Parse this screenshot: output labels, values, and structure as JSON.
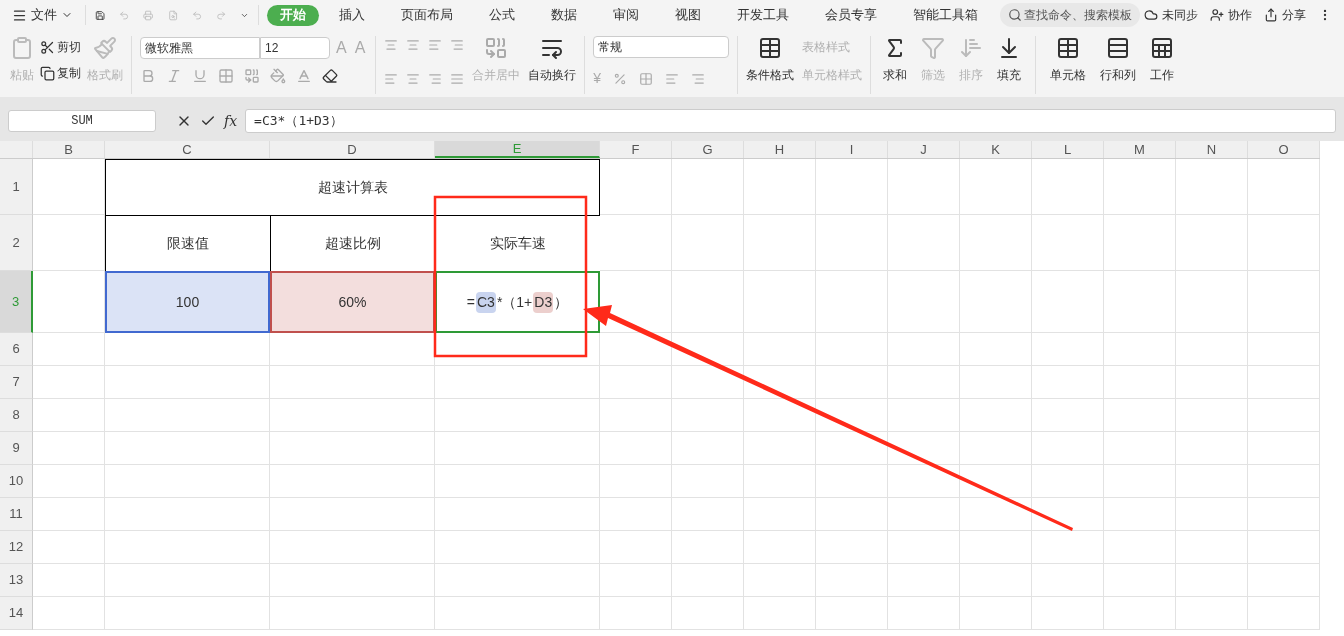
{
  "menu": {
    "file": "文件",
    "tabs": [
      {
        "label": "开始",
        "selected": true
      },
      {
        "label": "插入",
        "selected": false
      },
      {
        "label": "页面布局",
        "selected": false
      },
      {
        "label": "公式",
        "selected": false
      },
      {
        "label": "数据",
        "selected": false
      },
      {
        "label": "审阅",
        "selected": false
      },
      {
        "label": "视图",
        "selected": false
      },
      {
        "label": "开发工具",
        "selected": false
      },
      {
        "label": "会员专享",
        "selected": false
      },
      {
        "label": "智能工具箱",
        "selected": false
      }
    ],
    "search": {
      "placeholder": "查找命令、搜索模板"
    },
    "actions": [
      {
        "kind": "sync",
        "label": "未同步"
      },
      {
        "kind": "collab",
        "label": "协作"
      },
      {
        "kind": "share",
        "label": "分享"
      }
    ]
  },
  "ribbon": {
    "paste": {
      "label": "粘贴",
      "disabled": true
    },
    "cut": {
      "label": "剪切",
      "disabled": false
    },
    "copy": {
      "label": "复制",
      "disabled": false
    },
    "format_painter": {
      "label": "格式刷",
      "disabled": true
    },
    "font": "微软雅黑",
    "size": "12",
    "font_grow": "A",
    "font_shrink": "A",
    "currency": "¥",
    "merge": {
      "label": "合并居中",
      "disabled": true
    },
    "wrap": {
      "label": "自动换行",
      "disabled": false
    },
    "number_format": "常规",
    "conditional": {
      "label": "条件格式",
      "disabled": false
    },
    "table_style": {
      "label": "表格样式",
      "disabled": true
    },
    "cell_style": {
      "label": "单元格样式",
      "disabled": true
    },
    "big_buttons": [
      {
        "kind": "sum",
        "label": "求和",
        "disabled": false
      },
      {
        "kind": "filter",
        "label": "筛选",
        "disabled": true
      },
      {
        "kind": "sort",
        "label": "排序",
        "disabled": true
      },
      {
        "kind": "fill",
        "label": "填充",
        "disabled": false
      },
      {
        "kind": "cell",
        "label": "单元格",
        "disabled": false
      },
      {
        "kind": "rowcol",
        "label": "行和列",
        "disabled": false
      },
      {
        "kind": "sheet",
        "label": "工作",
        "disabled": false
      }
    ]
  },
  "formula_bar": {
    "name_box": "SUM",
    "fx": "fx",
    "formula": "=C3*（1+D3）"
  },
  "sheet": {
    "columns": [
      {
        "label": "B",
        "selected": false
      },
      {
        "label": "C",
        "selected": false
      },
      {
        "label": "D",
        "selected": false
      },
      {
        "label": "E",
        "selected": true
      },
      {
        "label": "F",
        "selected": false
      },
      {
        "label": "G",
        "selected": false
      },
      {
        "label": "H",
        "selected": false
      },
      {
        "label": "I",
        "selected": false
      },
      {
        "label": "J",
        "selected": false
      },
      {
        "label": "K",
        "selected": false
      },
      {
        "label": "L",
        "selected": false
      },
      {
        "label": "M",
        "selected": false
      },
      {
        "label": "N",
        "selected": false
      },
      {
        "label": "O",
        "selected": false
      }
    ],
    "rows": [
      {
        "label": "1",
        "selected": false
      },
      {
        "label": "2",
        "selected": false
      },
      {
        "label": "3",
        "selected": true
      },
      {
        "label": "6",
        "selected": false
      },
      {
        "label": "7",
        "selected": false
      },
      {
        "label": "8",
        "selected": false
      },
      {
        "label": "9",
        "selected": false
      },
      {
        "label": "10",
        "selected": false
      },
      {
        "label": "11",
        "selected": false
      },
      {
        "label": "12",
        "selected": false
      },
      {
        "label": "13",
        "selected": false
      },
      {
        "label": "14",
        "selected": false
      }
    ],
    "title": "超速计算表",
    "headers": [
      "限速值",
      "超速比例",
      "实际车速"
    ],
    "values": [
      {
        "text": "100",
        "color": "#4169d0"
      },
      {
        "text": "60%",
        "color": "#c0504d"
      }
    ],
    "formula_parts": [
      {
        "kind": "plain",
        "text": "="
      },
      {
        "kind": "ref",
        "color": "#c9d4ef",
        "text": "C3"
      },
      {
        "kind": "plain",
        "text": "*（1+"
      },
      {
        "kind": "ref",
        "color": "#eccfcd",
        "text": "D3"
      },
      {
        "kind": "plain",
        "text": "）"
      }
    ]
  }
}
